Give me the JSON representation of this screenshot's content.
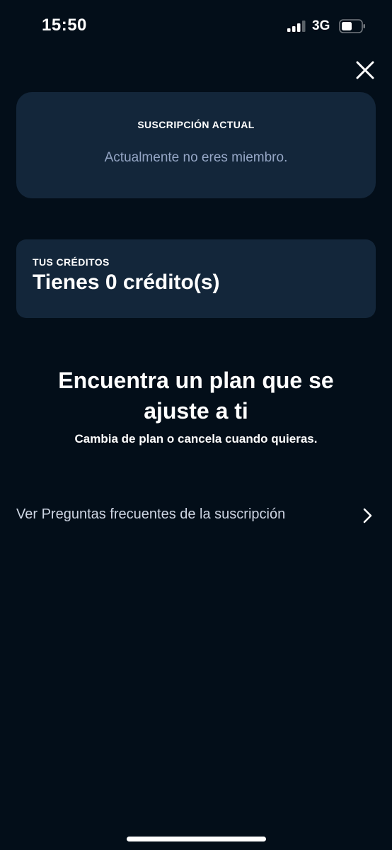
{
  "status_bar": {
    "time": "15:50",
    "network": "3G",
    "icons": [
      "signal-bars-icon",
      "battery-icon"
    ]
  },
  "header": {
    "close_icon": "close-icon"
  },
  "subscription": {
    "label": "SUSCRIPCIÓN ACTUAL",
    "status": "Actualmente no eres miembro."
  },
  "credits": {
    "label": "TUS CRÉDITOS",
    "value": "Tienes 0 crédito(s)"
  },
  "plans": {
    "heading": "Encuentra un plan que se ajuste a ti",
    "subheading": "Cambia de plan o cancela cuando quieras."
  },
  "faq": {
    "label": "Ver Preguntas frecuentes de la suscripción",
    "icon": "chevron-right-icon"
  },
  "colors": {
    "background": "#030e19",
    "card": "#13263a",
    "muted_text": "#95a6c5"
  }
}
